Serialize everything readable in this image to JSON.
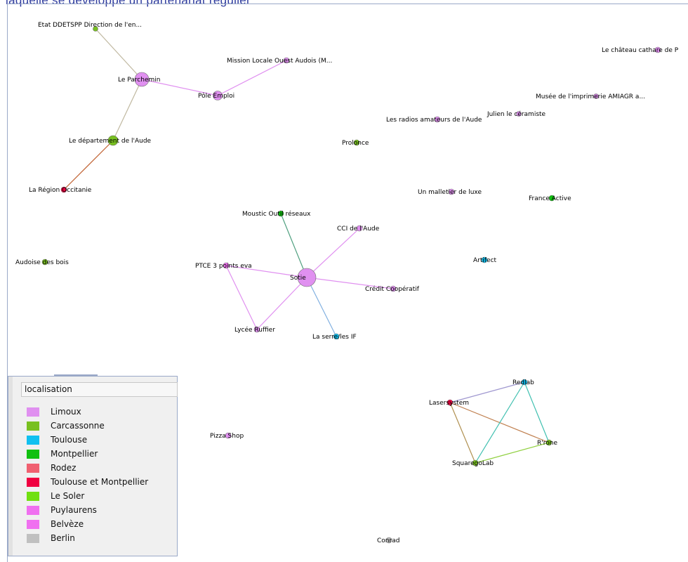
{
  "header": {
    "text": "laquelle se développe un partenariat régulier"
  },
  "colors": {
    "Limoux": "#e090f0",
    "Carcassonne": "#78c020",
    "Toulouse": "#10c0f0",
    "Montpellier": "#10c010",
    "Rodez": "#f06070",
    "Toulouse et Montpellier": "#f00040",
    "Le Soler": "#70e010",
    "Puylaurens": "#f070f0",
    "Belvèze": "#f070f0",
    "Berlin": "#c0c0c0"
  },
  "legend": {
    "title": "localisation",
    "items": [
      {
        "label": "Limoux",
        "color": "#e090f0"
      },
      {
        "label": "Carcassonne",
        "color": "#78c020"
      },
      {
        "label": "Toulouse",
        "color": "#10c0f0"
      },
      {
        "label": "Montpellier",
        "color": "#10c010"
      },
      {
        "label": "Rodez",
        "color": "#f06070"
      },
      {
        "label": "Toulouse et Montpellier",
        "color": "#f00040"
      },
      {
        "label": "Le Soler",
        "color": "#70e010"
      },
      {
        "label": "Puylaurens",
        "color": "#f070f0"
      },
      {
        "label": "Belvèze",
        "color": "#f070f0"
      },
      {
        "label": "Berlin",
        "color": "#c0c0c0"
      }
    ]
  },
  "graph": {
    "nodes": [
      {
        "id": "ddetspp",
        "label": "Etat DDETSPP Direction de l'en...",
        "color": "#78c020"
      },
      {
        "id": "parchemin",
        "label": "Le Parchemin",
        "color": "#e090f0"
      },
      {
        "id": "pole",
        "label": "Pôle Emploi",
        "color": "#e090f0"
      },
      {
        "id": "mission",
        "label": "Mission Locale Ouest Audois (M...",
        "color": "#e090f0"
      },
      {
        "id": "departement",
        "label": "Le département de l'Aude",
        "color": "#78c020"
      },
      {
        "id": "region",
        "label": "La Région Occitanie",
        "color": "#f00040"
      },
      {
        "id": "chateau",
        "label": "Le château cathare de P",
        "color": "#e090f0"
      },
      {
        "id": "musee",
        "label": "Musée de l'imprimerie AMIAGR a...",
        "color": "#e090f0"
      },
      {
        "id": "julien",
        "label": "Julien le céramiste",
        "color": "#e090f0"
      },
      {
        "id": "radios",
        "label": "Les radios amateurs de l'Aude",
        "color": "#e090f0"
      },
      {
        "id": "prolonce",
        "label": "Prolonce",
        "color": "#78c020"
      },
      {
        "id": "malletier",
        "label": "Un malletier de luxe",
        "color": "#e090f0"
      },
      {
        "id": "franceactive",
        "label": "France Active",
        "color": "#10c010"
      },
      {
        "id": "moustic",
        "label": "Moustic Outil réseaux",
        "color": "#10c010"
      },
      {
        "id": "cci",
        "label": "CCI de l'Aude",
        "color": "#e090f0"
      },
      {
        "id": "audoise",
        "label": "Audoise des bois",
        "color": "#78c020"
      },
      {
        "id": "artifect",
        "label": "Artifect",
        "color": "#10c0f0"
      },
      {
        "id": "ptce",
        "label": "PTCE 3 points eva",
        "color": "#f070f0"
      },
      {
        "id": "sotie",
        "label": "Sotie",
        "color": "#e090f0"
      },
      {
        "id": "credit",
        "label": "Crédit Coopératif",
        "color": "#e090f0"
      },
      {
        "id": "lycee",
        "label": "Lycée Ruffier",
        "color": "#e090f0"
      },
      {
        "id": "serres",
        "label": "La serre/les IF",
        "color": "#10c0f0"
      },
      {
        "id": "redlab",
        "label": "Redlab",
        "color": "#10c0f0"
      },
      {
        "id": "lasersystem",
        "label": "Lasersystem",
        "color": "#f00040"
      },
      {
        "id": "rone",
        "label": "R'rone",
        "color": "#78c020"
      },
      {
        "id": "squarego",
        "label": "SquaregoLab",
        "color": "#78c020"
      },
      {
        "id": "pizza",
        "label": "Pizza Shop",
        "color": "#e090f0"
      },
      {
        "id": "conrad",
        "label": "Conrad",
        "color": "#c0c0c0"
      }
    ],
    "edges": [
      {
        "from": "ddetspp",
        "to": "parchemin",
        "color": "#c0b8a0"
      },
      {
        "from": "parchemin",
        "to": "pole",
        "color": "#e090f0"
      },
      {
        "from": "pole",
        "to": "mission",
        "color": "#e090f0"
      },
      {
        "from": "parchemin",
        "to": "departement",
        "color": "#c0b8a0"
      },
      {
        "from": "departement",
        "to": "region",
        "color": "#c06030"
      },
      {
        "from": "moustic",
        "to": "sotie",
        "color": "#50a080"
      },
      {
        "from": "cci",
        "to": "sotie",
        "color": "#e090f0"
      },
      {
        "from": "ptce",
        "to": "sotie",
        "color": "#e090f0"
      },
      {
        "from": "sotie",
        "to": "credit",
        "color": "#e090f0"
      },
      {
        "from": "sotie",
        "to": "lycee",
        "color": "#e090f0"
      },
      {
        "from": "ptce",
        "to": "lycee",
        "color": "#e090f0"
      },
      {
        "from": "sotie",
        "to": "serres",
        "color": "#80b0e0"
      },
      {
        "from": "lasersystem",
        "to": "redlab",
        "color": "#a098d0"
      },
      {
        "from": "lasersystem",
        "to": "rone",
        "color": "#c08050"
      },
      {
        "from": "lasersystem",
        "to": "squarego",
        "color": "#b09050"
      },
      {
        "from": "redlab",
        "to": "rone",
        "color": "#40c0b0"
      },
      {
        "from": "redlab",
        "to": "squarego",
        "color": "#40c0b0"
      },
      {
        "from": "squarego",
        "to": "rone",
        "color": "#90d040"
      }
    ]
  }
}
